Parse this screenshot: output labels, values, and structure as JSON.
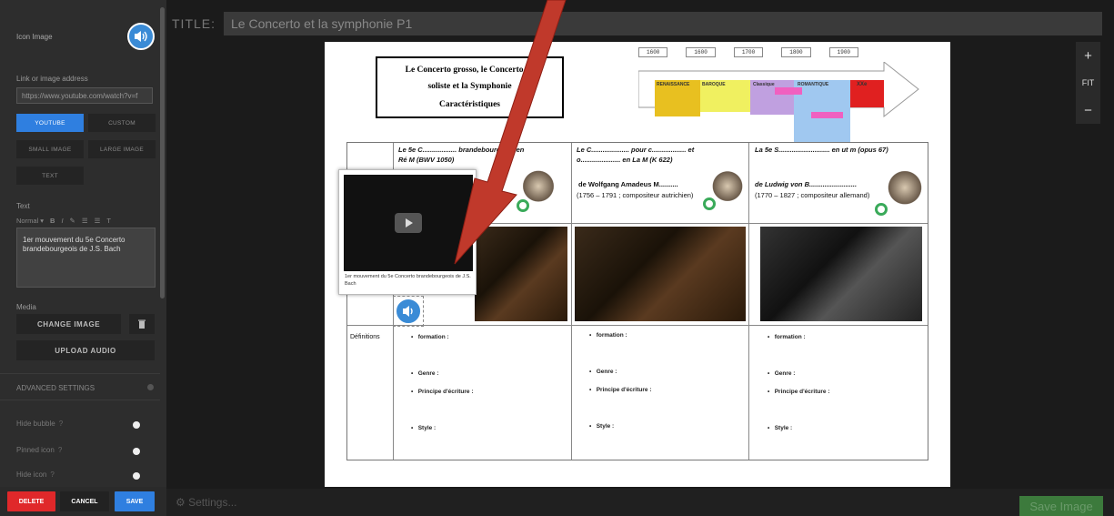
{
  "left_panel": {
    "icon_image_label": "Icon Image",
    "link_label": "Link or image address",
    "url_value": "https://www.youtube.com/watch?v=f",
    "media_type_buttons": [
      "YOUTUBE",
      "CUSTOM",
      "SMALL IMAGE",
      "LARGE IMAGE",
      "TEXT"
    ],
    "active_media_type": "YOUTUBE",
    "text_label": "Text",
    "toolbar_format": "Normal",
    "text_value": "1er mouvement du 5e Concerto brandebourgeois de J.S. Bach",
    "media_label": "Media",
    "change_image": "CHANGE IMAGE",
    "upload_audio": "UPLOAD AUDIO",
    "advanced_settings": "ADVANCED SETTINGS",
    "toggles": [
      "Hide bubble",
      "Pinned icon",
      "Hide icon"
    ],
    "delete": "DELETE",
    "cancel": "CANCEL",
    "save": "SAVE"
  },
  "header": {
    "title_label": "TITLE:",
    "title_value": "Le Concerto et la symphonie P1"
  },
  "zoom": {
    "plus": "+",
    "fit": "FIT",
    "minus": "−"
  },
  "bottom": {
    "settings": "Settings...",
    "save_image": "Save Image"
  },
  "document": {
    "title_lines": [
      "Le Concerto grosso,  le Concerto de",
      "soliste et la Symphonie",
      "Caractéristiques"
    ],
    "timeline_years": [
      "1600",
      "1600",
      "1700",
      "1800",
      "1900"
    ],
    "periods": [
      "RENAISSANCE",
      "BAROQUE",
      "Classique",
      "ROMANTIQUE",
      "XXe"
    ],
    "composers": [
      {
        "line1": "Le 5e C.................. brandebourgeois en",
        "line2": "Ré M (BWV 1050)",
        "line3": "",
        "line4": "teur"
      },
      {
        "line1": "Le C.................... pour c.................. et",
        "line2": "o..................... en La M (K 622)",
        "line3": "de Wolfgang Amadeus M..........",
        "line4": "(1756 – 1791 ; compositeur autrichien)"
      },
      {
        "line1": "La 5e  S........................... en ut m (opus 67)",
        "line2": "",
        "line3": "de Ludwig von B.........................",
        "line4": "(1770 – 1827 ; compositeur allemand)"
      }
    ],
    "row_label": "Définitions",
    "bullets": [
      "formation :",
      "Genre :",
      "Principe d'écriture :",
      "Style :"
    ]
  },
  "popup": {
    "caption": "1er mouvement du 5e Concerto brandebourgeois de J.S. Bach"
  },
  "colors": {
    "accent": "#2f7fe0",
    "delete": "#e0282a",
    "save": "#2f7fe0",
    "arrow": "#c0392b"
  }
}
